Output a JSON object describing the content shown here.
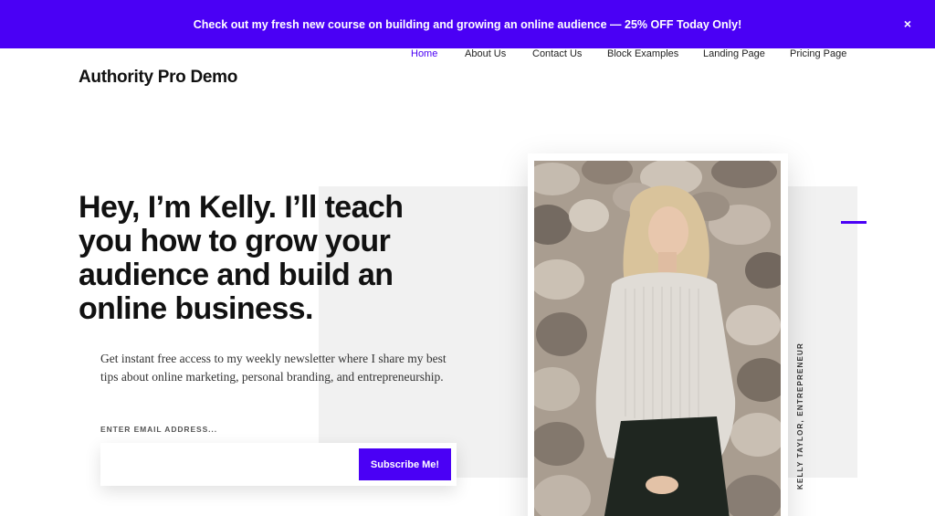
{
  "promo": {
    "text": "Check out my fresh new course on building and growing an online audience — 25% OFF Today Only!",
    "close_glyph": "×"
  },
  "header": {
    "site_title": "Authority Pro Demo",
    "nav": [
      {
        "label": "Home",
        "active": true
      },
      {
        "label": "About Us",
        "active": false
      },
      {
        "label": "Contact Us",
        "active": false
      },
      {
        "label": "Block Examples",
        "active": false
      },
      {
        "label": "Landing Page",
        "active": false
      },
      {
        "label": "Pricing Page",
        "active": false
      }
    ]
  },
  "hero": {
    "title": "Hey, I’m Kelly. I’ll teach you how to grow your audience and build an online business.",
    "description": "Get instant free access to my weekly newsletter where I share my best tips about online marketing, personal branding, and entrepreneurship.",
    "email_label": "ENTER EMAIL ADDRESS...",
    "email_value": "",
    "subscribe_label": "Subscribe Me!",
    "photo_caption": "KELLY TAYLOR, ENTREPRENEUR"
  },
  "colors": {
    "accent": "#4a00f5",
    "panel": "#f1f1f1",
    "text": "#111111"
  },
  "icons": {
    "close": "close-icon"
  }
}
